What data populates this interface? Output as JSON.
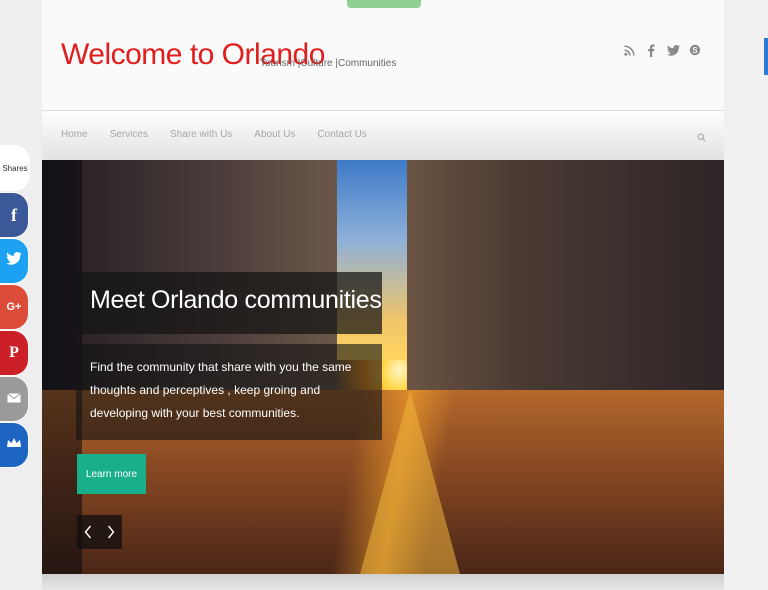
{
  "header": {
    "title": "Welcome to Orlando",
    "tagline": "Tourism |Culture |Communities",
    "social_icons": [
      "rss-icon",
      "facebook-icon",
      "twitter-icon",
      "skype-icon"
    ]
  },
  "nav": {
    "items": [
      {
        "label": "Home"
      },
      {
        "label": "Services"
      },
      {
        "label": "Share with Us"
      },
      {
        "label": "About Us"
      },
      {
        "label": "Contact Us"
      }
    ],
    "search_icon": "search-icon"
  },
  "slide": {
    "title": "Meet Orlando communities",
    "text": "Find the community that share with you the same thoughts and perceptives , keep groing and developing with your best communities.",
    "cta_label": "Learn more",
    "prev_icon": "chevron-left-icon",
    "next_icon": "chevron-right-icon"
  },
  "share_bar": {
    "label": "Shares",
    "buttons": [
      {
        "network": "facebook",
        "glyph": "f",
        "color": "#3b5998"
      },
      {
        "network": "twitter",
        "glyph": "t",
        "color": "#1da1f2"
      },
      {
        "network": "google-plus",
        "glyph": "G+",
        "color": "#dd4b39"
      },
      {
        "network": "pinterest",
        "glyph": "P",
        "color": "#cb2027"
      },
      {
        "network": "email",
        "glyph": "✉",
        "color": "#9a9a9a"
      },
      {
        "network": "sumome",
        "glyph": "♛",
        "color": "#1e65c2"
      }
    ]
  },
  "colors": {
    "title_red": "#e21d1d",
    "cta_green": "#1aaf8b",
    "nav_text": "#a6a6a6"
  }
}
